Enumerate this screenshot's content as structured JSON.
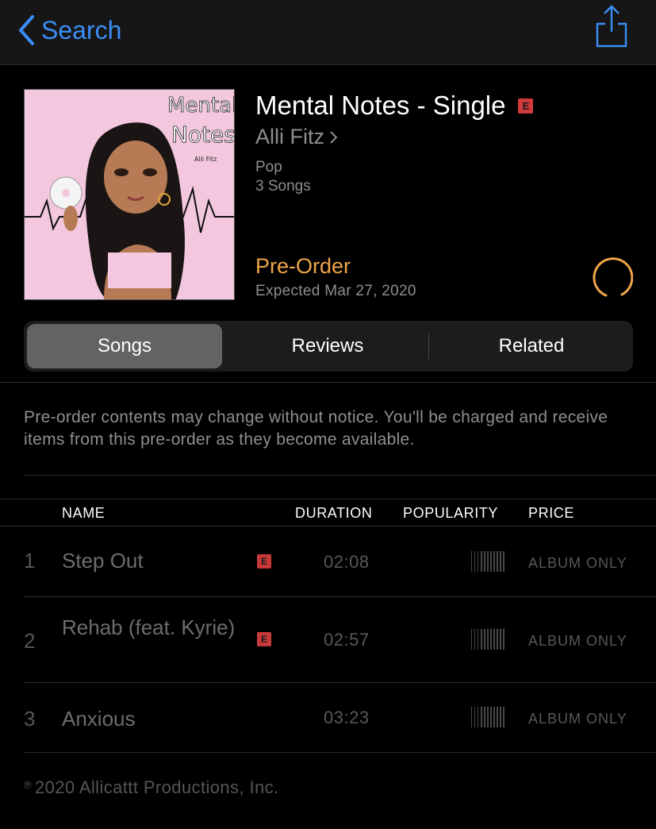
{
  "nav": {
    "back_label": "Search",
    "share_icon": "share-icon"
  },
  "album": {
    "title": "Mental Notes - Single",
    "explicit": "E",
    "artist": "Alli Fitz",
    "genre": "Pop",
    "song_count": "3 Songs",
    "preorder_label": "Pre-Order",
    "expected": "Expected Mar 27, 2020",
    "cover_text_1": "Mental",
    "cover_text_2": "Notes",
    "cover_text_3": "Alli Fitz"
  },
  "tabs": {
    "songs": "Songs",
    "reviews": "Reviews",
    "related": "Related",
    "selected": "Songs"
  },
  "notice": "Pre-order contents may change without notice. You'll be charged and receive items from this pre-order as they become available.",
  "table": {
    "headers": {
      "name": "NAME",
      "duration": "DURATION",
      "popularity": "POPULARITY",
      "price": "PRICE"
    },
    "rows": [
      {
        "num": "1",
        "title": "Step Out",
        "explicit": "E",
        "duration": "02:08",
        "price": "ALBUM ONLY"
      },
      {
        "num": "2",
        "title": "Rehab (feat. Kyrie)",
        "explicit": "E",
        "duration": "02:57",
        "price": "ALBUM ONLY"
      },
      {
        "num": "3",
        "title": "Anxious",
        "explicit": "",
        "duration": "03:23",
        "price": "ALBUM ONLY"
      }
    ]
  },
  "copyright_symbol": "℗",
  "copyright": "2020 Allicattt Productions, Inc.",
  "colors": {
    "accent_blue": "#3a8ef6",
    "preorder_orange": "#f0a54a",
    "explicit_red": "#d23b3b"
  }
}
